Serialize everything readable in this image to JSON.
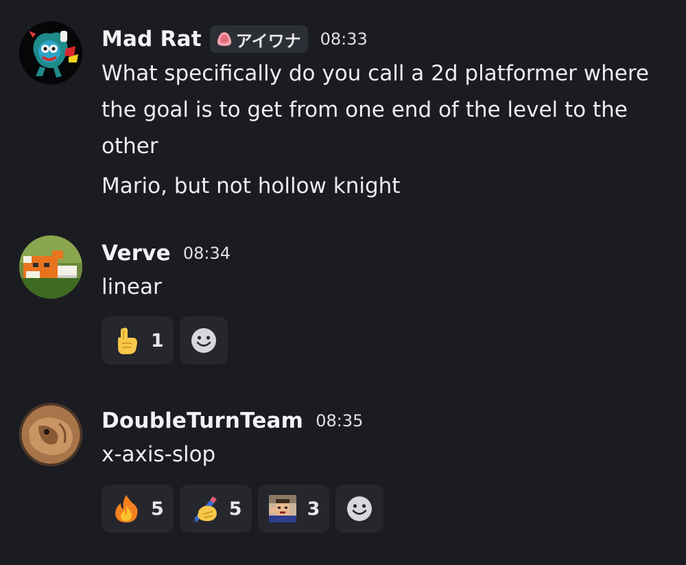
{
  "messages": [
    {
      "username": "Mad Rat",
      "tag": "アイワナ",
      "time": "08:33",
      "lines": [
        "What specifically do you call a 2d platformer where",
        "the goal is to get from one end of the level to the",
        "other"
      ],
      "followup": "Mario, but not hollow knight"
    },
    {
      "username": "Verve",
      "time": "08:34",
      "text": "linear",
      "reactions": [
        {
          "emoji": "point-up-emoji",
          "count": "1"
        }
      ]
    },
    {
      "username": "DoubleTurnTeam",
      "time": "08:35",
      "text": "x-axis-slop",
      "reactions": [
        {
          "emoji": "fire-emoji",
          "count": "5"
        },
        {
          "emoji": "writing-hand-emoji",
          "count": "5"
        },
        {
          "emoji": "custom-face-emoji",
          "count": "3"
        }
      ]
    }
  ],
  "colors": {
    "background": "#1b1c21",
    "reaction_bg": "#25272d",
    "tag_bg": "#2d2f36"
  }
}
